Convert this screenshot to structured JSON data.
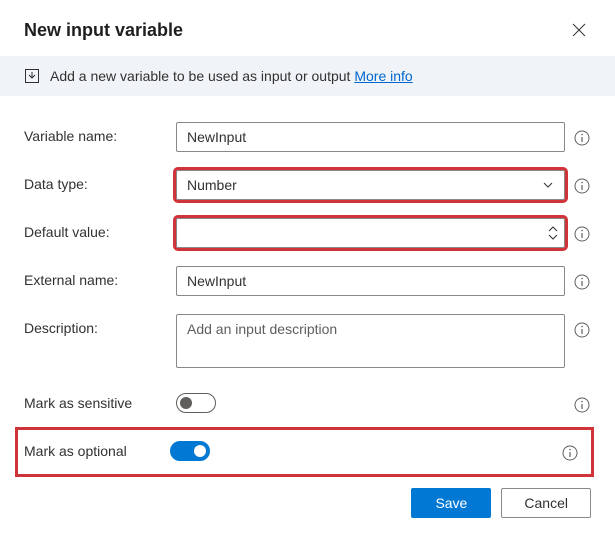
{
  "dialog": {
    "title": "New input variable",
    "banner_text": "Add a new variable to be used as input or output",
    "banner_link": "More info"
  },
  "fields": {
    "variable_name": {
      "label": "Variable name:",
      "value": "NewInput"
    },
    "data_type": {
      "label": "Data type:",
      "value": "Number"
    },
    "default_value": {
      "label": "Default value:",
      "value": ""
    },
    "external_name": {
      "label": "External name:",
      "value": "NewInput"
    },
    "description": {
      "label": "Description:",
      "placeholder": "Add an input description",
      "value": ""
    },
    "mark_sensitive": {
      "label": "Mark as sensitive",
      "on": false
    },
    "mark_optional": {
      "label": "Mark as optional",
      "on": true
    }
  },
  "buttons": {
    "save": "Save",
    "cancel": "Cancel"
  }
}
